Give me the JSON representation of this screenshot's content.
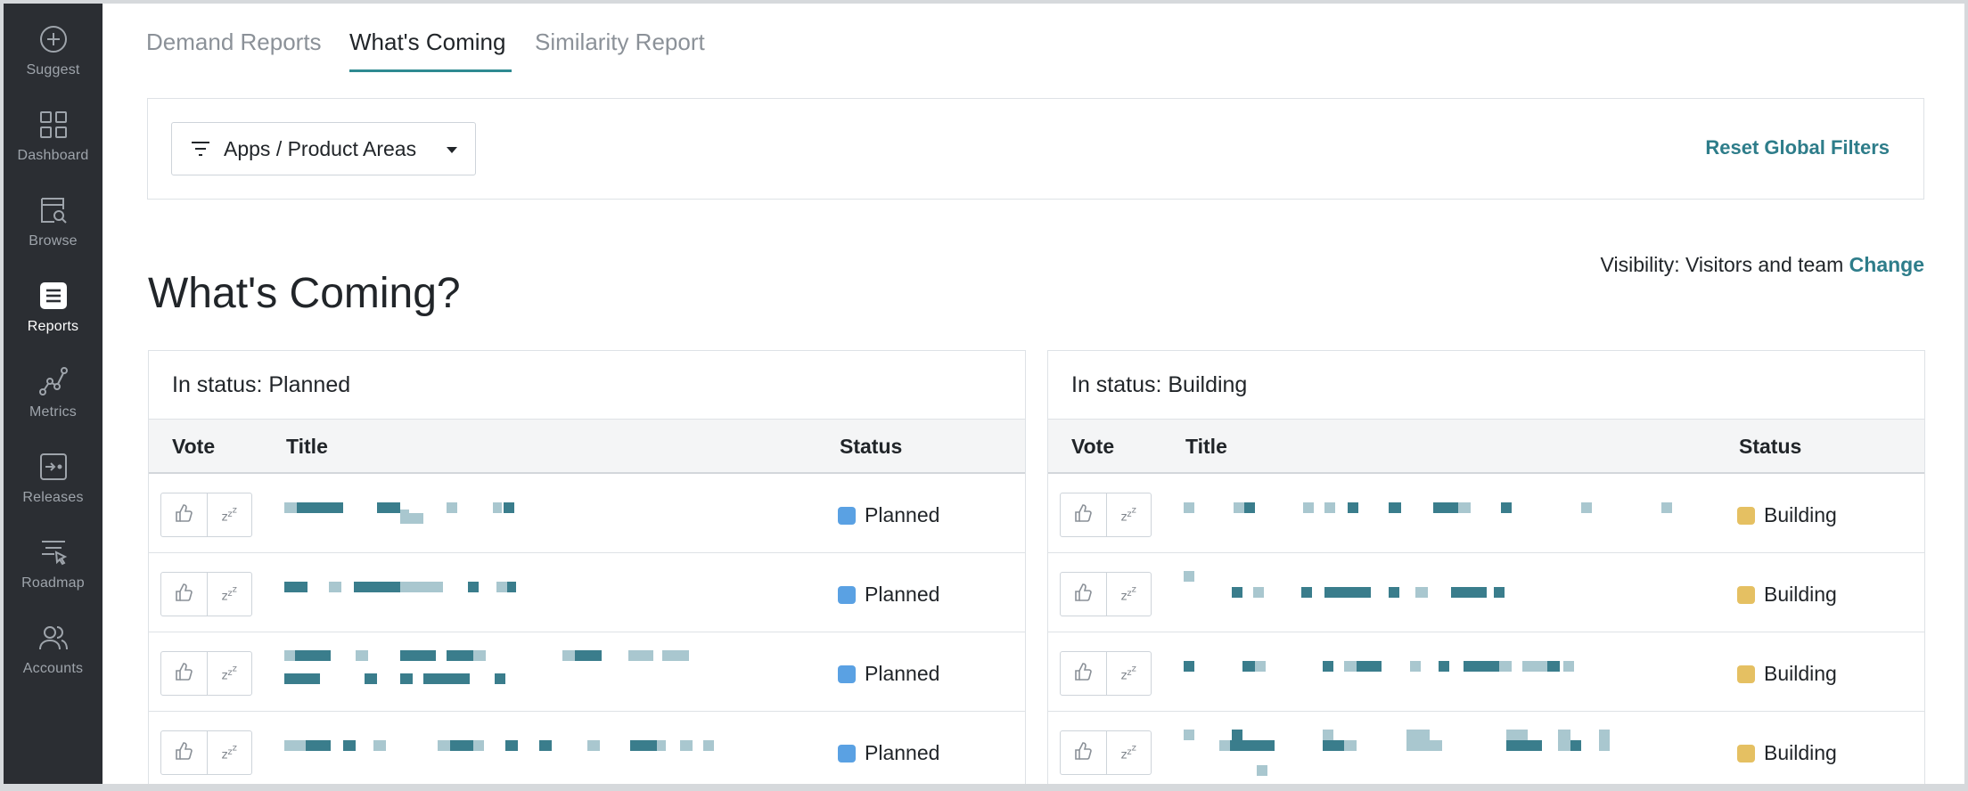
{
  "sidebar": {
    "items": [
      {
        "label": "Suggest",
        "icon": "plus-circle-icon"
      },
      {
        "label": "Dashboard",
        "icon": "grid-icon"
      },
      {
        "label": "Browse",
        "icon": "browse-search-icon"
      },
      {
        "label": "Reports",
        "icon": "list-icon",
        "active": true
      },
      {
        "label": "Metrics",
        "icon": "line-chart-icon"
      },
      {
        "label": "Releases",
        "icon": "release-icon"
      },
      {
        "label": "Roadmap",
        "icon": "roadmap-icon"
      },
      {
        "label": "Accounts",
        "icon": "users-icon"
      }
    ]
  },
  "tabs": [
    {
      "label": "Demand Reports"
    },
    {
      "label": "What's Coming",
      "active": true
    },
    {
      "label": "Similarity Report"
    }
  ],
  "filters": {
    "dropdown_label": "Apps / Product Areas",
    "reset_label": "Reset Global Filters"
  },
  "page": {
    "title": "What's Coming?",
    "visibility_label": "Visibility: Visitors and team",
    "visibility_change": "Change"
  },
  "colors": {
    "accent": "#2e8a91",
    "link": "#2e7d8a",
    "sidebar_bg": "#2b2e33",
    "planned": "#5aa1e3",
    "building": "#e5c062",
    "redacted_dark": "#3a7d8c",
    "redacted_light": "#a9c7cf"
  },
  "panels": [
    {
      "heading": "In status: Planned",
      "columns": {
        "vote": "Vote",
        "title": "Title",
        "status": "Status"
      },
      "rows": [
        {
          "status": "Planned",
          "title_redacted": true
        },
        {
          "status": "Planned",
          "title_redacted": true
        },
        {
          "status": "Planned",
          "title_redacted": true
        },
        {
          "status": "Planned",
          "title_redacted": true
        }
      ]
    },
    {
      "heading": "In status: Building",
      "columns": {
        "vote": "Vote",
        "title": "Title",
        "status": "Status"
      },
      "rows": [
        {
          "status": "Building",
          "title_redacted": true
        },
        {
          "status": "Building",
          "title_redacted": true
        },
        {
          "status": "Building",
          "title_redacted": true
        },
        {
          "status": "Building",
          "title_redacted": true
        }
      ]
    }
  ],
  "vote_buttons": {
    "upvote_icon": "thumbs-up-icon",
    "snooze_icon": "snooze-zzz-icon",
    "snooze_text": "z"
  }
}
